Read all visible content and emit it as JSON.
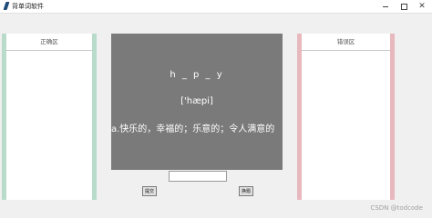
{
  "window": {
    "title": "背单词软件",
    "controls": {
      "minimize_icon": "minimize-icon",
      "maximize_icon": "maximize-icon",
      "close_glyph": "✕"
    }
  },
  "left_panel": {
    "header": "正确区",
    "accent_color": "#b8dcc9"
  },
  "right_panel": {
    "header": "错误区",
    "accent_color": "#e7b8be"
  },
  "card": {
    "word": "h _ p _ y",
    "phonetic": "['hæpi]",
    "meaning": "a.快乐的，幸福的；乐意的；令人满意的",
    "background_color": "#7a7a7a"
  },
  "answer_input": {
    "value": "",
    "placeholder": ""
  },
  "buttons": {
    "submit_label": "提交",
    "swap_label": "换题"
  },
  "watermark": "CSDN @todcode"
}
